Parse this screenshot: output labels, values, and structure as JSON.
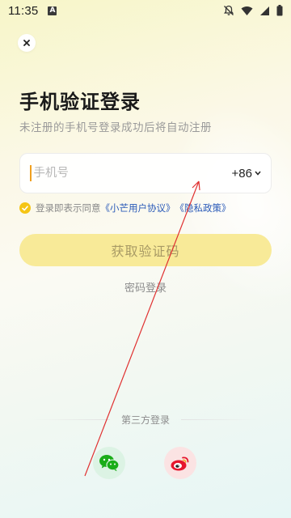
{
  "status_bar": {
    "time": "11:35",
    "notification_icon": "A",
    "icons": [
      "bell-off-icon",
      "wifi-icon",
      "signal-icon",
      "battery-icon"
    ]
  },
  "header": {
    "close_icon": "close-icon",
    "title": "手机验证登录",
    "subtitle": "未注册的手机号登录成功后将自动注册"
  },
  "phone_input": {
    "value": "",
    "placeholder": "手机号",
    "country_code": "+86"
  },
  "agreement": {
    "checked": true,
    "prefix": "登录即表示同意",
    "user_agreement": "《小芒用户协议》",
    "privacy_policy": "《隐私政策》"
  },
  "actions": {
    "get_code": "获取验证码",
    "password_login": "密码登录"
  },
  "third_party": {
    "title": "第三方登录",
    "providers": [
      "wechat-icon",
      "weibo-icon"
    ]
  },
  "colors": {
    "accent": "#f5c515",
    "button_disabled": "#f8ea98",
    "link": "#2a5ab8",
    "wechat": "#1aad19",
    "weibo": "#e6162d"
  }
}
